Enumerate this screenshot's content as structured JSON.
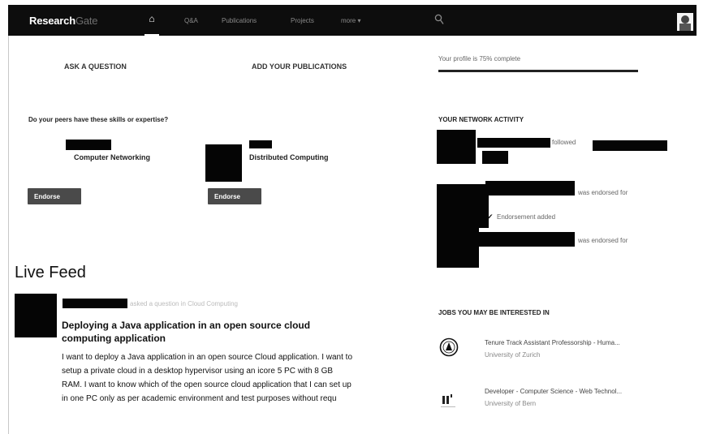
{
  "nav": {
    "logo_primary": "Research",
    "logo_secondary": "Gate",
    "home_glyph": "⌂",
    "items": [
      "Q&A",
      "Publications",
      "Projects",
      "more ▾"
    ]
  },
  "actions": {
    "ask_question": "ASK A QUESTION",
    "add_publications": "ADD YOUR PUBLICATIONS"
  },
  "profile": {
    "completion_text": "Your profile is 75% complete",
    "completion_fraction": 0.75
  },
  "skills": {
    "heading": "Do your peers have these skills or expertise?",
    "cards": [
      {
        "label": "Computer Networking",
        "button": "Endorse"
      },
      {
        "label": "Distributed Computing",
        "button": "Endorse"
      }
    ]
  },
  "network": {
    "heading": "YOUR NETWORK ACTIVITY",
    "items": [
      {
        "text": "followed"
      },
      {
        "text": "was endorsed for"
      },
      {
        "text": "Endorsement added"
      },
      {
        "text": "was endorsed for"
      }
    ]
  },
  "feed": {
    "title": "Live Feed",
    "post": {
      "meta": "asked a question in Cloud Computing",
      "title": "Deploying a Java application in an open source cloud computing application",
      "body": "I want to deploy a Java application in an open source Cloud application. I want to setup a private cloud in a desktop hypervisor using an icore 5 PC with 8 GB RAM. I want to know which of the open source cloud application that I can set up in one PC only as per academic environment and test purposes without requ"
    }
  },
  "jobs": {
    "heading": "JOBS YOU MAY BE INTERESTED IN",
    "items": [
      {
        "title": "Tenure Track Assistant Professorship - Huma...",
        "org": "University of Zurich"
      },
      {
        "title": "Developer - Computer Science - Web Technol...",
        "org": "University of Bern"
      }
    ]
  },
  "icons": [
    "home-icon",
    "search-icon",
    "avatar",
    "check-icon",
    "university-seal-icon",
    "university-logo-icon"
  ]
}
